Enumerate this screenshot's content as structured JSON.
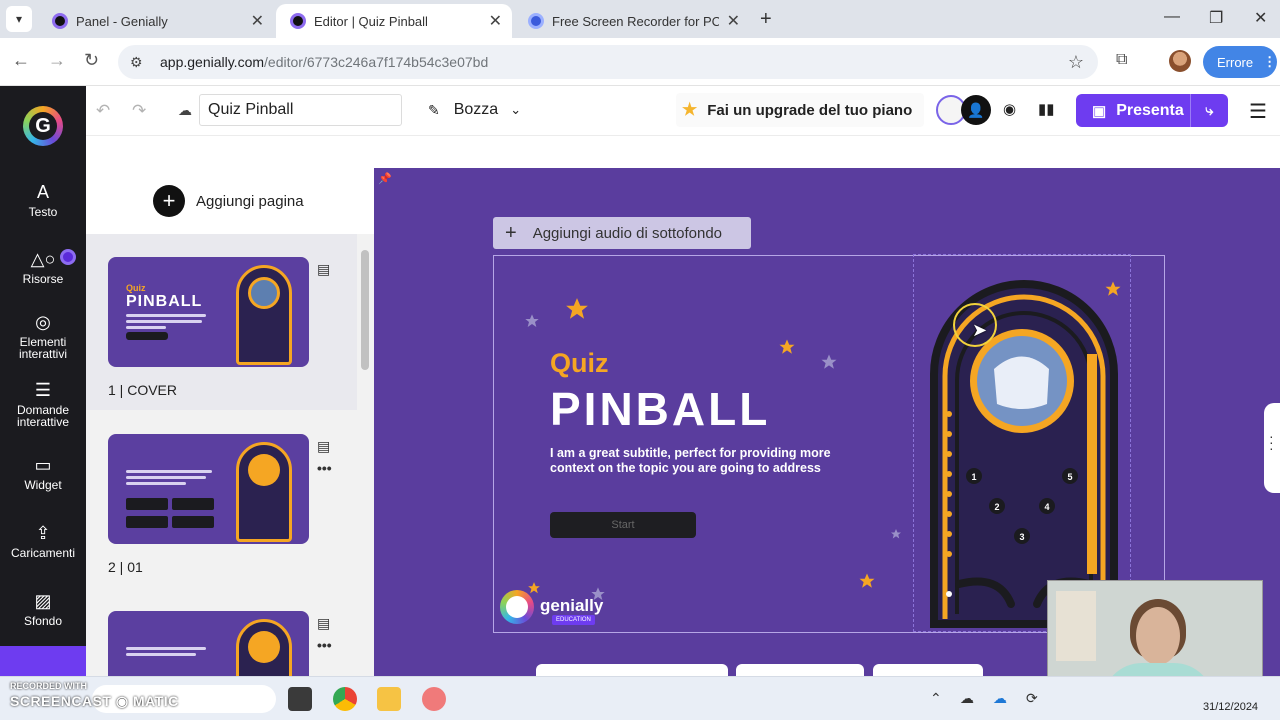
{
  "browser": {
    "tabs": [
      {
        "title": "Panel - Genially",
        "active": false
      },
      {
        "title": "Editor | Quiz Pinball",
        "active": true
      },
      {
        "title": "Free Screen Recorder for PC, M",
        "active": false
      }
    ],
    "url_host": "app.genially.com",
    "url_path": "/editor/6773c246a7f174b54c3e07bd",
    "profile_button": "Errore"
  },
  "rail": {
    "items": [
      {
        "label": "Testo",
        "icon": "A"
      },
      {
        "label": "Risorse",
        "icon": "△○"
      },
      {
        "label": "Elementi interattivi",
        "icon": "◎"
      },
      {
        "label": "Domande interattive",
        "icon": "☰"
      },
      {
        "label": "Widget",
        "icon": "▭"
      },
      {
        "label": "Caricamenti",
        "icon": "⇪"
      },
      {
        "label": "Sfondo",
        "icon": "▨"
      }
    ]
  },
  "header": {
    "title": "Quiz Pinball",
    "status": "Bozza",
    "upgrade": "Fai un upgrade del tuo piano",
    "present": "Presenta"
  },
  "pages": {
    "add_label": "Aggiungi pagina",
    "items": [
      {
        "number": "1",
        "name": "COVER"
      },
      {
        "number": "2",
        "name": "01"
      }
    ]
  },
  "canvas": {
    "audio_label": "Aggiungi audio di sottofondo",
    "slide": {
      "quiz": "Quiz",
      "title": "PINBALL",
      "subtitle": "I am a great subtitle, perfect for providing more context on the topic you are going to address",
      "button": "Start",
      "logo_text": "genially",
      "logo_badge": "EDUCATION"
    },
    "bumpers": [
      "1",
      "2",
      "3",
      "4",
      "5"
    ]
  },
  "taskbar": {
    "watermark_top": "RECORDED WITH",
    "watermark_brand": "SCREENCAST ◉ MATIC",
    "date": "31/12/2024"
  },
  "colors": {
    "accent": "#6e3cf0",
    "canvas_bg": "#5a3d9e",
    "pinball_orange": "#f5a623"
  }
}
